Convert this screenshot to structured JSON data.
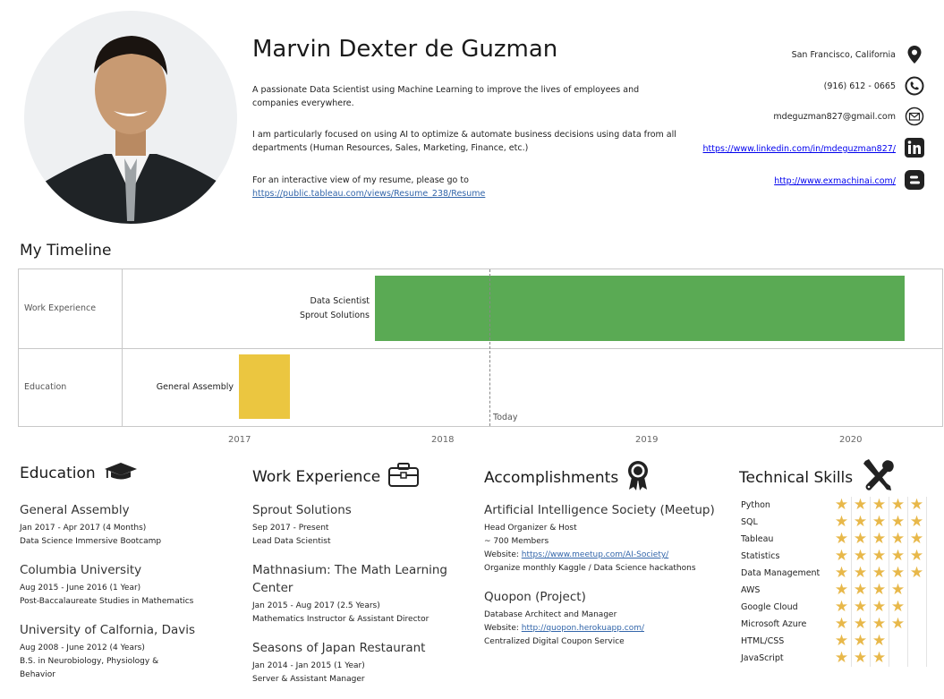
{
  "profile": {
    "name": "Marvin Dexter de Guzman",
    "bio_1": "A passionate Data Scientist using Machine Learning to improve the lives of employees and companies everywhere.",
    "bio_2": "I am particularly focused on using AI to optimize & automate business decisions using data from all departments (Human Resources, Sales, Marketing, Finance, etc.)",
    "bio_3": "For an interactive view of my resume, please go to",
    "bio_link": "https://public.tableau.com/views/Resume_238/Resume"
  },
  "contact": {
    "location": "San Francisco, California",
    "phone": "(916) 612 - 0665",
    "email": "mdeguzman827@gmail.com",
    "linkedin": "https://www.linkedin.com/in/mdeguzman827/",
    "blog": "http://www.exmachinai.com/",
    "icons": [
      "location-pin-icon",
      "phone-icon",
      "email-icon",
      "linkedin-icon",
      "blogger-icon"
    ]
  },
  "timeline": {
    "title": "My Timeline",
    "rows": [
      "Work Experience",
      "Education"
    ],
    "work_label_1": "Data Scientist",
    "work_label_2": "Sprout Solutions",
    "edu_label": "General Assembly",
    "today_label": "Today",
    "axis": [
      "2017",
      "2018",
      "2019",
      "2020"
    ],
    "colors": {
      "work": "#5aaa54",
      "education": "#ebc640"
    }
  },
  "education": {
    "title": "Education",
    "entries": [
      {
        "title": "General Assembly",
        "lines": [
          "Jan 2017 - Apr 2017 (4 Months)",
          "Data Science Immersive Bootcamp"
        ]
      },
      {
        "title": "Columbia University",
        "lines": [
          "Aug 2015 - June 2016 (1 Year)",
          "Post-Baccalaureate Studies in Mathematics"
        ]
      },
      {
        "title": "University of Calfornia, Davis",
        "lines": [
          "Aug 2008 - June 2012 (4 Years)",
          "B.S. in Neurobiology, Physiology &",
          "Behavior"
        ]
      }
    ]
  },
  "work": {
    "title": "Work Experience",
    "entries": [
      {
        "title": "Sprout Solutions",
        "lines": [
          "Sep 2017 - Present",
          "Lead Data Scientist"
        ]
      },
      {
        "title": "Mathnasium: The Math Learning Center",
        "lines": [
          "Jan 2015 - Aug 2017 (2.5 Years)",
          "Mathematics Instructor & Assistant Director"
        ]
      },
      {
        "title": "Seasons of Japan Restaurant",
        "lines": [
          "Jan 2014 - Jan 2015 (1 Year)",
          "Server & Assistant Manager"
        ]
      }
    ]
  },
  "accomplishments": {
    "title": "Accomplishments",
    "entries": [
      {
        "title": "Artificial Intelligence Society (Meetup)",
        "lines": [
          "Head Organizer & Host",
          "~ 700 Members"
        ],
        "website_label": "Website: ",
        "website": "https://www.meetup.com/AI-Society/",
        "extra": "Organize monthly Kaggle / Data Science hackathons"
      },
      {
        "title": "Quopon (Project)",
        "lines": [
          "Database Architect and Manager"
        ],
        "website_label": "Website: ",
        "website": "http://quopon.herokuapp.com/",
        "extra": "Centralized Digital Coupon Service"
      }
    ]
  },
  "skills": {
    "title": "Technical Skills",
    "items": [
      {
        "name": "Python",
        "rating": 5
      },
      {
        "name": "SQL",
        "rating": 5
      },
      {
        "name": "Tableau",
        "rating": 5
      },
      {
        "name": "Statistics",
        "rating": 5
      },
      {
        "name": "Data Management",
        "rating": 5
      },
      {
        "name": "AWS",
        "rating": 4
      },
      {
        "name": "Google Cloud",
        "rating": 4
      },
      {
        "name": "Microsoft Azure",
        "rating": 4
      },
      {
        "name": "HTML/CSS",
        "rating": 3
      },
      {
        "name": "JavaScript",
        "rating": 3
      }
    ],
    "max_rating": 5,
    "star_color": "#e8b84a"
  }
}
